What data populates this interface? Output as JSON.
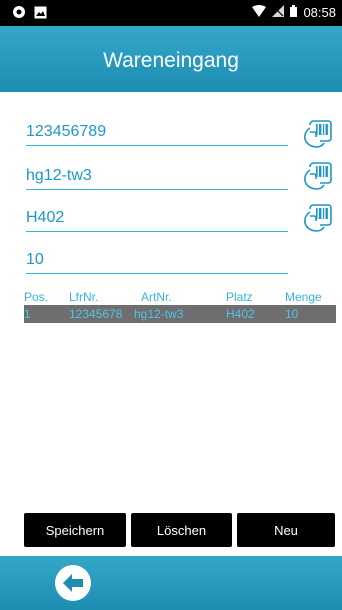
{
  "status_bar": {
    "time": "08:58"
  },
  "header": {
    "title": "Wareneingang"
  },
  "form": {
    "lieferant": "123456789",
    "artikel": "hg12-tw3",
    "platz": "H402",
    "menge": "10"
  },
  "table": {
    "headers": [
      "Pos.",
      "LfrNr.",
      "ArtNr.",
      "Platz",
      "Menge"
    ],
    "rows": [
      [
        "1",
        "12345678",
        "hg12-tw3",
        "H402",
        "10"
      ]
    ]
  },
  "buttons": {
    "save": "Speichern",
    "delete": "Löschen",
    "new": "Neu"
  },
  "colors": {
    "accent": "#1d8db2",
    "text_accent": "#1c98c8"
  }
}
